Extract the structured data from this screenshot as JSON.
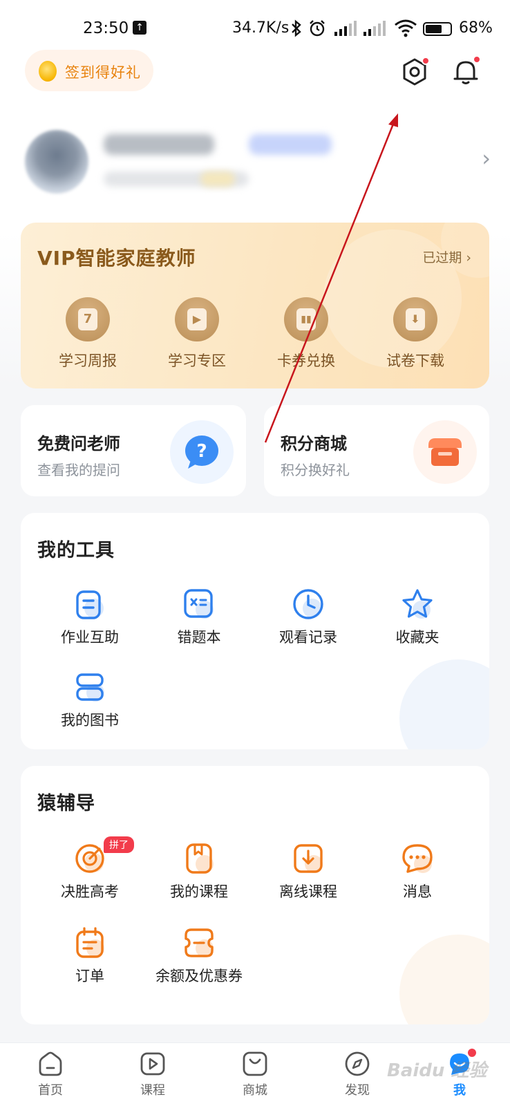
{
  "status_bar": {
    "time": "23:50",
    "upload_icon": "↑",
    "net_speed": "34.7K/s",
    "battery_pct": "68%",
    "battery_level": 0.68
  },
  "header": {
    "signin_label": "签到得好礼",
    "settings_icon": "settings-icon",
    "bell_icon": "bell-icon"
  },
  "profile": {
    "chevron": "›"
  },
  "vip": {
    "title": "VIP智能家庭教师",
    "status": "已过期 ›",
    "items": [
      {
        "label": "学习周报",
        "glyph": "7"
      },
      {
        "label": "学习专区",
        "glyph": "▶"
      },
      {
        "label": "卡券兑换",
        "glyph": "▮▮"
      },
      {
        "label": "试卷下载",
        "glyph": "⬇"
      }
    ]
  },
  "cards": {
    "ask_teacher": {
      "title": "免费问老师",
      "subtitle": "查看我的提问",
      "icon": "question-bubble-icon"
    },
    "points_mall": {
      "title": "积分商城",
      "subtitle": "积分换好礼",
      "icon": "shop-icon"
    }
  },
  "tools": {
    "title": "我的工具",
    "items": [
      {
        "label": "作业互助",
        "icon": "homework-icon"
      },
      {
        "label": "错题本",
        "icon": "mistake-book-icon"
      },
      {
        "label": "观看记录",
        "icon": "clock-icon"
      },
      {
        "label": "收藏夹",
        "icon": "star-icon"
      },
      {
        "label": "我的图书",
        "icon": "books-icon"
      }
    ]
  },
  "tutoring": {
    "title": "猿辅导",
    "badge": "拼了",
    "items": [
      {
        "label": "决胜高考",
        "icon": "target-icon"
      },
      {
        "label": "我的课程",
        "icon": "course-book-icon"
      },
      {
        "label": "离线课程",
        "icon": "download-icon"
      },
      {
        "label": "消息",
        "icon": "chat-icon"
      },
      {
        "label": "订单",
        "icon": "order-icon"
      },
      {
        "label": "余额及优惠券",
        "icon": "wallet-icon"
      }
    ]
  },
  "tabbar": {
    "items": [
      {
        "label": "首页",
        "icon": "home-icon"
      },
      {
        "label": "课程",
        "icon": "play-icon"
      },
      {
        "label": "商城",
        "icon": "bag-icon"
      },
      {
        "label": "发现",
        "icon": "compass-icon"
      },
      {
        "label": "我",
        "icon": "me-icon"
      }
    ]
  },
  "watermark": "Baidu 经验",
  "colors": {
    "accent_blue": "#1a8cff",
    "accent_orange": "#f07a1a",
    "vip_brown": "#8a5a1c",
    "red_dot": "#f23c4b",
    "annotation_arrow": "#c8161d"
  }
}
